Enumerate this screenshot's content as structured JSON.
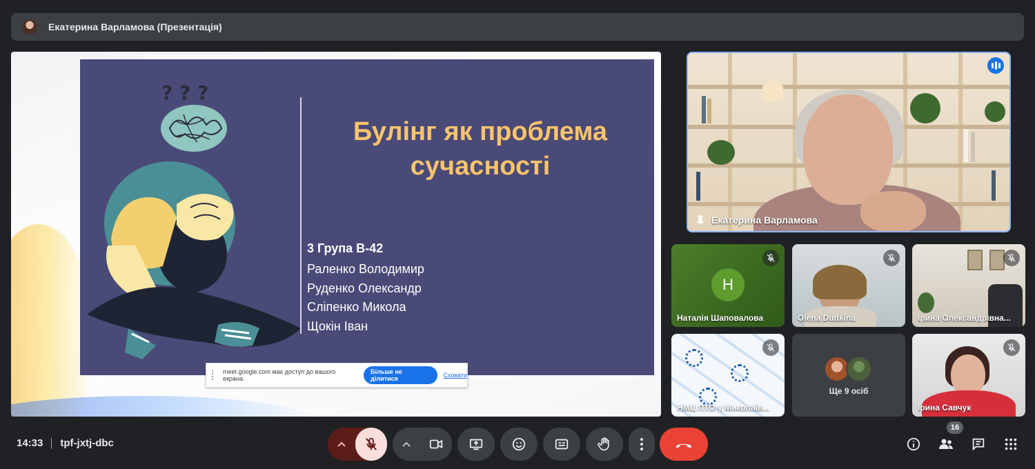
{
  "presenter_bar": {
    "title": "Екатерина Варламова (Презентація)"
  },
  "slide": {
    "title": "Булінг як проблема сучасності",
    "group": "3 Група В-42",
    "members": [
      "Раленко Володимир",
      "Руденко Олександр",
      "Сліпенко Микола",
      "Щокін Іван"
    ],
    "art_glyphs": "? ? ?"
  },
  "share_banner": {
    "text": "meet.google.com має доступ до вашого екрана.",
    "stop_label": "Більше не ділитися",
    "hide_label": "Сховати"
  },
  "main_video": {
    "name": "Екатерина Варламова",
    "speaking": true
  },
  "tiles": [
    {
      "name": "Наталія Шаповалова",
      "initial": "Н",
      "muted": true
    },
    {
      "name": "Olena Dudkina",
      "muted": true
    },
    {
      "name": "Ірина Олександрівна...",
      "muted": true
    },
    {
      "name": "НМЦ ПТО у Миколаїв...",
      "muted": true
    },
    {
      "name": "Ще 9 осіб"
    },
    {
      "name": "Ірина Савчук",
      "muted": true
    }
  ],
  "meeting": {
    "time": "14:33",
    "code": "tpf-jxtj-dbc",
    "participants_count": "16"
  },
  "colors": {
    "accent": "#1a73e8",
    "end_call": "#ea4335",
    "mic_off": "#f9dedc",
    "slide_bg": "#4a4a78",
    "slide_title": "#f9c46b"
  },
  "icons": [
    "mic-off-icon",
    "camera-icon",
    "present-icon",
    "emoji-icon",
    "captions-icon",
    "raise-hand-icon",
    "more-options-icon",
    "end-call-icon",
    "info-icon",
    "people-icon",
    "chat-icon",
    "activities-icon"
  ]
}
